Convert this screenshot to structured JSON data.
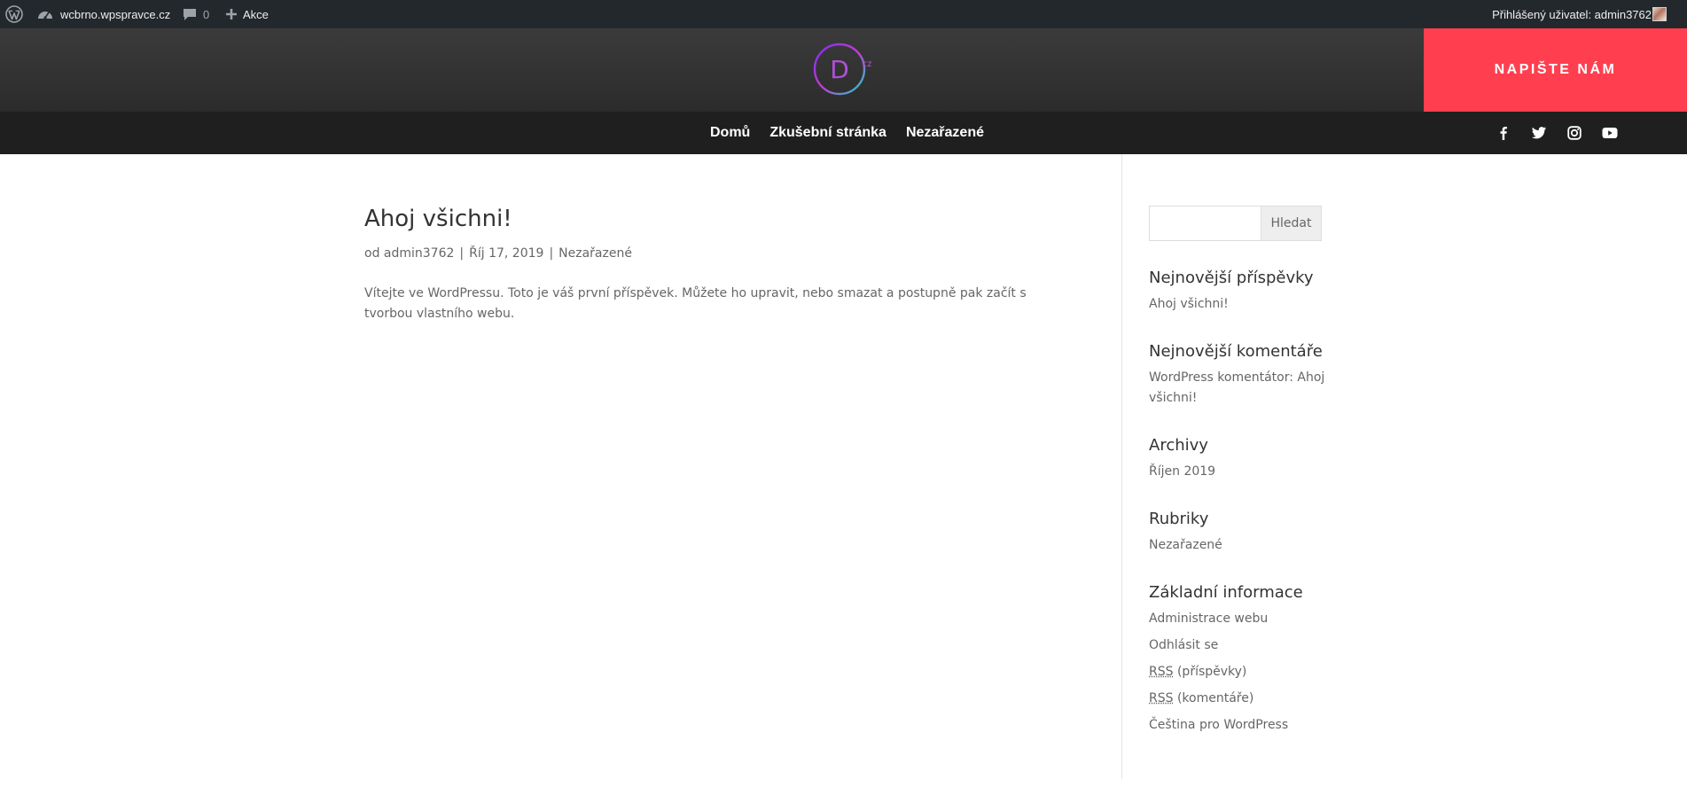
{
  "admin_bar": {
    "wp_logo_icon": "wordpress-icon",
    "site_icon": "dashboard-icon",
    "site_name": "wcbrno.wpspravce.cz",
    "comments_icon": "comment-bubble-icon",
    "comments_count": "0",
    "new_icon": "plus-icon",
    "new_label": "Akce",
    "account_label": "Přihlášený uživatel: admin3762"
  },
  "header": {
    "logo_letter": "D",
    "logo_suffix": "cz",
    "cta_label": "NAPIŠTE NÁM",
    "cta_color": "#ff3f4f"
  },
  "nav": {
    "items": [
      {
        "label": "Domů"
      },
      {
        "label": "Zkušební stránka"
      },
      {
        "label": "Nezařazené"
      }
    ],
    "social": [
      "facebook-icon",
      "twitter-icon",
      "instagram-icon",
      "youtube-icon"
    ]
  },
  "post": {
    "title": "Ahoj všichni!",
    "meta_prefix": "od",
    "author": "admin3762",
    "date": "Říj 17, 2019",
    "category": "Nezařazené",
    "excerpt": "Vítejte ve WordPressu. Toto je váš první příspěvek. Můžete ho upravit, nebo smazat a postupně pak začít s tvorbou vlastního webu."
  },
  "sidebar": {
    "search_button": "Hledat",
    "search_value": "",
    "widgets": {
      "recent_posts": {
        "title": "Nejnovější příspěvky",
        "items": [
          "Ahoj všichni!"
        ]
      },
      "recent_comments": {
        "title": "Nejnovější komentáře",
        "items": [
          "WordPress komentátor: Ahoj všichni!"
        ]
      },
      "archives": {
        "title": "Archivy",
        "items": [
          "Říjen 2019"
        ]
      },
      "categories": {
        "title": "Rubriky",
        "items": [
          "Nezařazené"
        ]
      },
      "meta": {
        "title": "Základní informace",
        "items": [
          "Administrace webu",
          "Odhlásit se"
        ],
        "rss_abbr": "RSS",
        "rss_posts": "(příspěvky)",
        "rss_comments": "(komentáře)",
        "wp_cz": "Čeština pro WordPress"
      }
    }
  }
}
